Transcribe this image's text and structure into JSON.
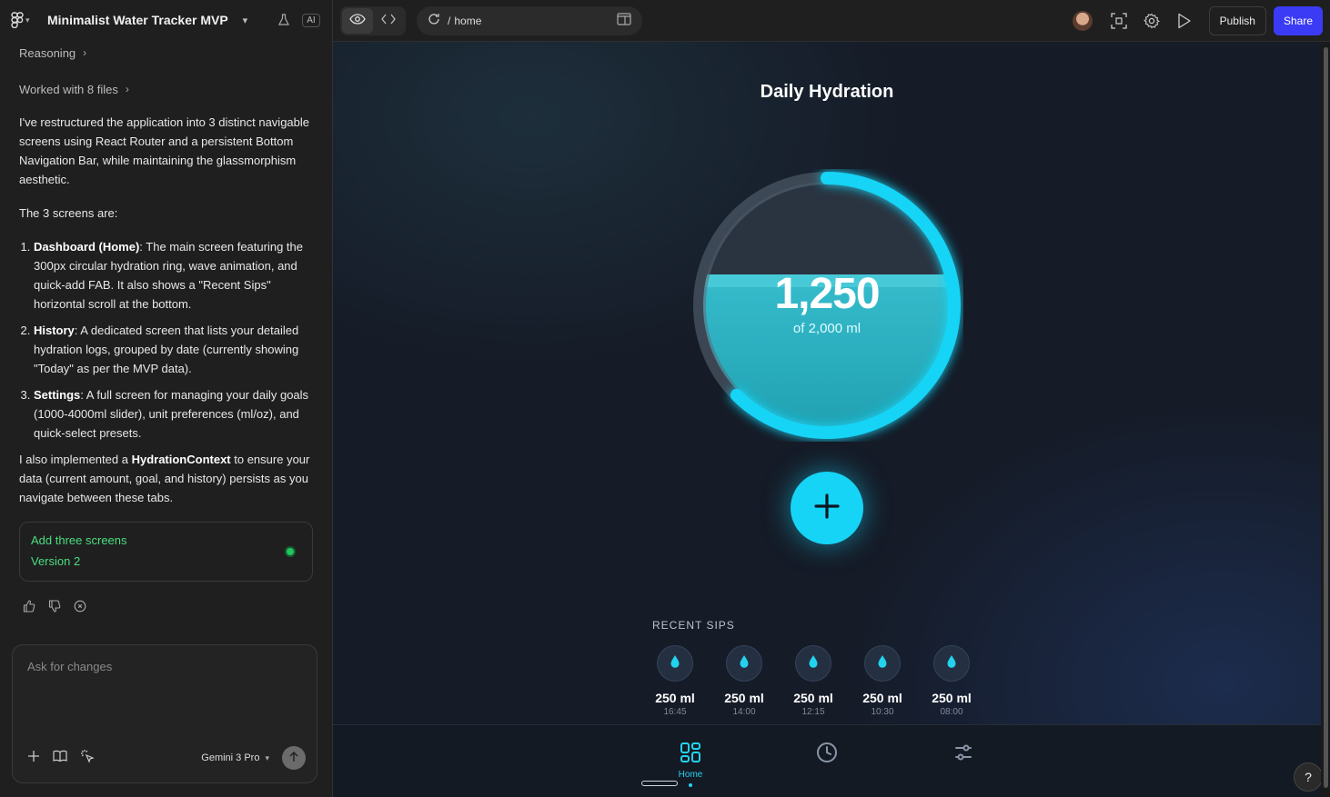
{
  "editor": {
    "project_title": "Minimalist Water Tracker MVP",
    "ai_badge": "AI",
    "reasoning_label": "Reasoning",
    "worked_files_label": "Worked with 8 files",
    "intro": "I've restructured the application into 3 distinct navigable screens using React Router and a persistent Bottom Navigation Bar, while maintaining the glassmorphism aesthetic.",
    "screens_intro": "The 3 screens are:",
    "screens": [
      {
        "title": "Dashboard (Home)",
        "text": ": The main screen featuring the 300px circular hydration ring, wave animation, and quick-add FAB. It also shows a \"Recent Sips\" horizontal scroll at the bottom."
      },
      {
        "title": "History",
        "text": ": A dedicated screen that lists your detailed hydration logs, grouped by date (currently showing \"Today\" as per the MVP data)."
      },
      {
        "title": "Settings",
        "text": ": A full screen for managing your daily goals (1000-4000ml slider), unit preferences (ml/oz), and quick-select presets."
      }
    ],
    "context_pre": "I also implemented a ",
    "context_bold": "HydrationContext",
    "context_post": " to ensure your data (current amount, goal, and history) persists as you navigate between these tabs.",
    "version_card": {
      "title": "Add three screens",
      "version": "Version 2"
    },
    "composer": {
      "placeholder": "Ask for changes",
      "model": "Gemini 3 Pro"
    }
  },
  "toolbar": {
    "url_prefix": "/",
    "url_path": "home",
    "publish_label": "Publish",
    "share_label": "Share"
  },
  "app": {
    "title": "Daily Hydration",
    "current_display": "1,250",
    "goal_display": "of 2,000 ml",
    "progress": 0.625,
    "accent_color": "#16d4f5",
    "recent_label": "RECENT SIPS",
    "sips": [
      {
        "amount": "250 ml",
        "time": "16:45"
      },
      {
        "amount": "250 ml",
        "time": "14:00"
      },
      {
        "amount": "250 ml",
        "time": "12:15"
      },
      {
        "amount": "250 ml",
        "time": "10:30"
      },
      {
        "amount": "250 ml",
        "time": "08:00"
      }
    ],
    "nav": {
      "home_label": "Home"
    },
    "help_label": "?"
  }
}
